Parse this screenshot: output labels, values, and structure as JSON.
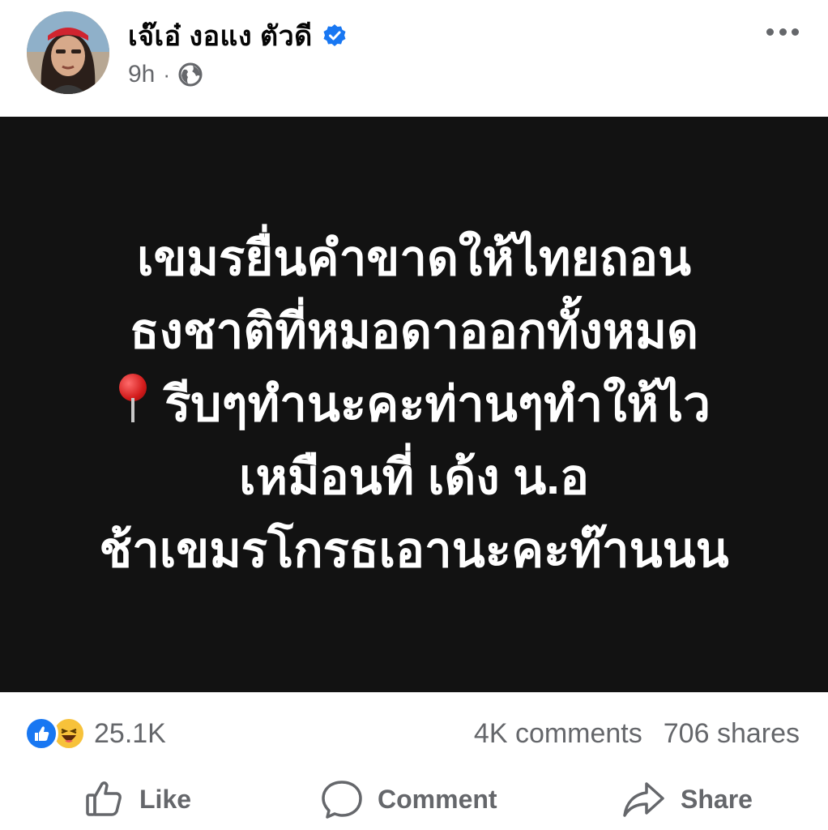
{
  "post": {
    "author": {
      "name": "เจ๊เอ๋ งอแง ตัวดี",
      "verified": true
    },
    "time": "9h",
    "separator": "·",
    "audience_icon": "globe-icon",
    "more_icon": "more-options-icon",
    "content": {
      "background": "#121212",
      "lines": [
        "เขมรยื่นคำขาดให้ไทยถอน",
        "ธงชาติที่หมอดาออกทั้งหมด",
        "รีบๆทำนะคะท่านๆทำให้ไว",
        "เหมือนที่ เด้ง น.อ",
        "ช้าเขมรโกรธเอานะคะท๊านนน"
      ],
      "pin_icon": "red-pushpin-emoji"
    },
    "reactions": {
      "types": [
        "like",
        "haha"
      ],
      "count": "25.1K"
    },
    "comments": "4K comments",
    "shares": "706 shares"
  },
  "actions": {
    "like": "Like",
    "comment": "Comment",
    "share": "Share"
  },
  "colors": {
    "accent": "#1877f2",
    "muted": "#65676b",
    "text": "#050505"
  }
}
